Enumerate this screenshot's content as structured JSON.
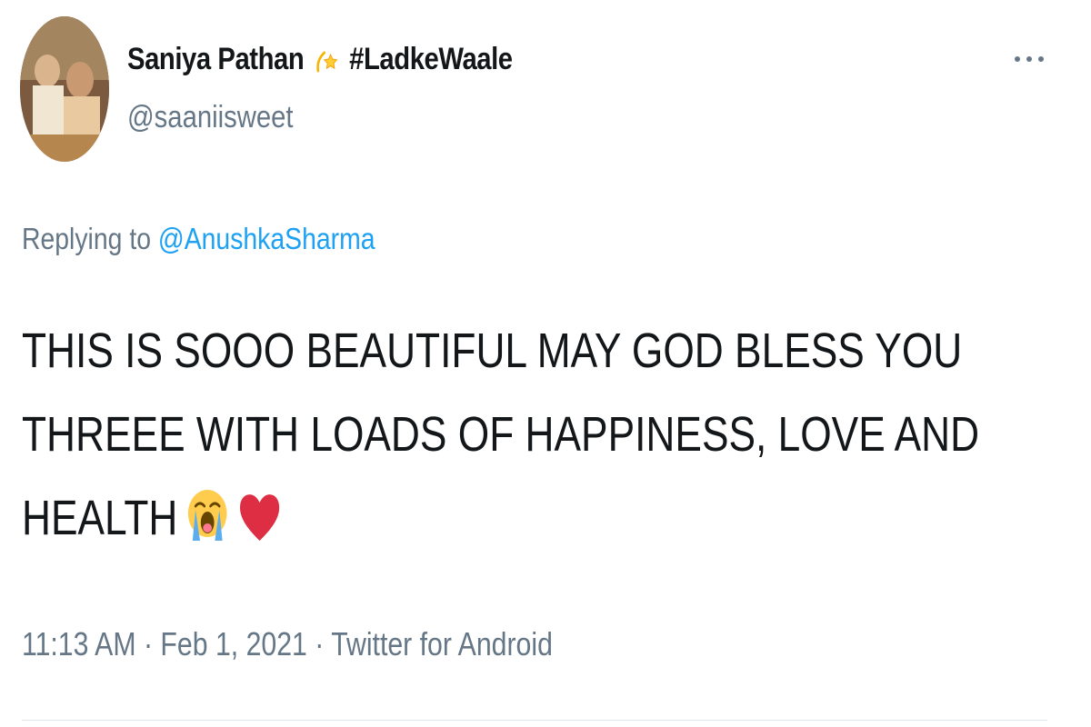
{
  "user": {
    "display_name": "Saniya Pathan",
    "name_emoji": "dizzy-star-emoji",
    "hashtag": "#LadkeWaale",
    "handle": "@saaniisweet",
    "avatar_icon": "profile-photo"
  },
  "menu": {
    "more_icon": "ellipsis-icon"
  },
  "reply": {
    "prefix": "Replying to",
    "mention": "@AnushkaSharma"
  },
  "tweet": {
    "lines": [
      "THIS IS SOOO BEAUTIFUL MAY GOD BLESS YOU",
      "THREEE WITH LOADS OF HAPPINESS, LOVE AND",
      "HEALTH"
    ],
    "emojis": [
      "loudly-crying-face-emoji",
      "red-heart-emoji"
    ]
  },
  "meta": {
    "time": "11:13 AM",
    "separator": "·",
    "date": "Feb 1, 2021",
    "source": "Twitter for Android"
  },
  "colors": {
    "text": "#14171a",
    "secondary": "#657786",
    "link": "#1da1f2",
    "divider": "#e1e8ed"
  }
}
